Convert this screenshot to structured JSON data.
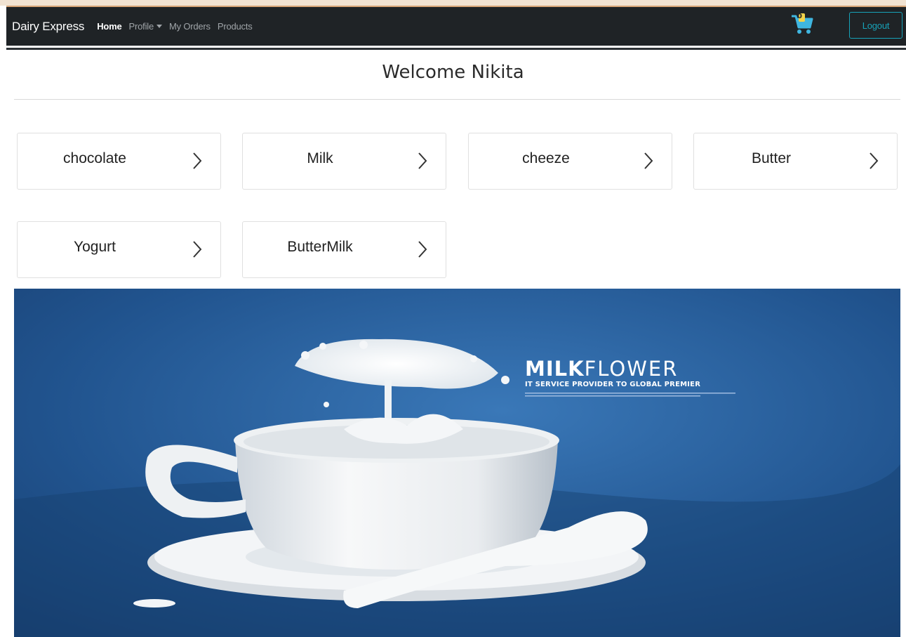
{
  "navbar": {
    "brand": "Dairy Express",
    "links": [
      {
        "label": "Home",
        "active": true
      },
      {
        "label": "Profile",
        "dropdown": true
      },
      {
        "label": "My Orders"
      },
      {
        "label": "Products"
      }
    ],
    "cart_count": "0",
    "cart_icon": "shopping-cart-icon",
    "logout_label": "Logout"
  },
  "page": {
    "welcome": "Welcome Nikita"
  },
  "categories": [
    {
      "label": "chocolate"
    },
    {
      "label": "Milk"
    },
    {
      "label": "cheeze"
    },
    {
      "label": "Butter"
    },
    {
      "label": "Yogurt"
    },
    {
      "label": "ButterMilk"
    }
  ],
  "banner": {
    "brand_bold": "MILK",
    "brand_light": "FLOWER",
    "tagline": "IT SERVICE PROVIDER TO GLOBAL PREMIER"
  },
  "colors": {
    "navbar_bg": "#1f2326",
    "accent": "#17a2b8",
    "banner_bg": "#1f4f86"
  }
}
